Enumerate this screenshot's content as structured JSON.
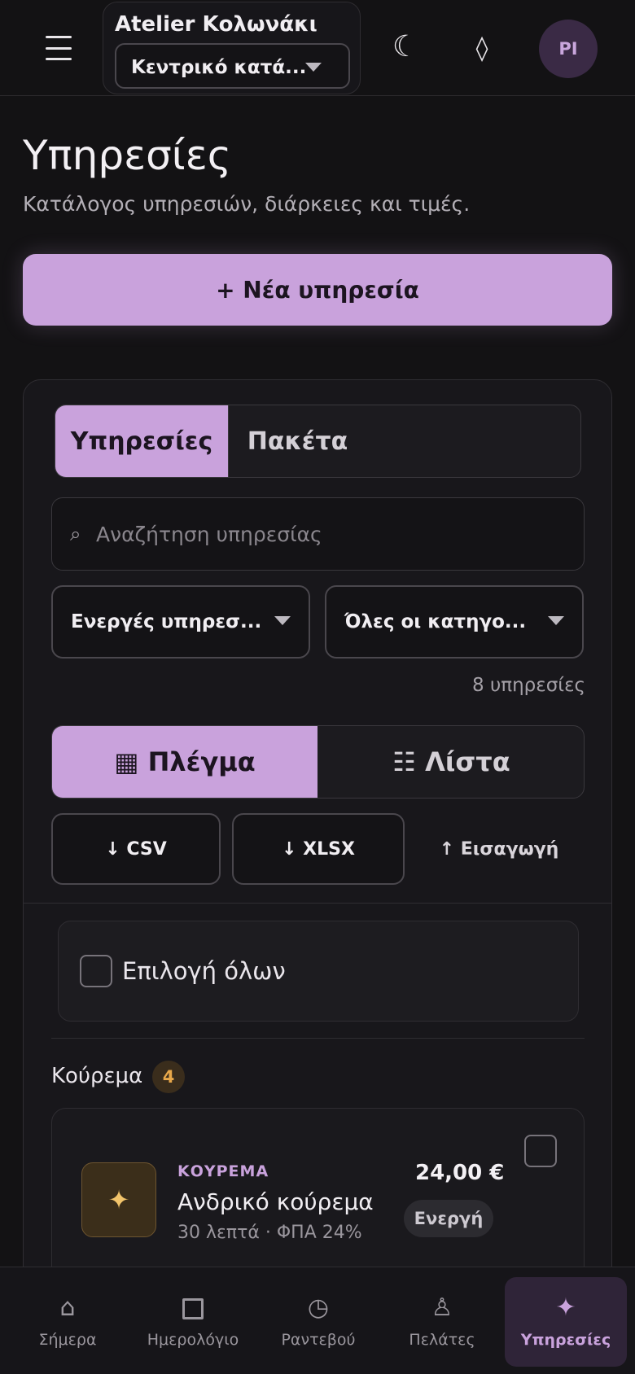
{
  "header": {
    "workspace_name": "Atelier Κολωνάκι",
    "location": "Κεντρικό κατά...",
    "theme_icon": "moon-icon",
    "extra_icon": "diamond-icon",
    "avatar_initials": "PI"
  },
  "page": {
    "title": "Υπηρεσίες",
    "subtitle": "Κατάλογος υπηρεσιών, διάρκειες και τιμές.",
    "new_button": "+ Νέα υπηρεσία"
  },
  "tabs": [
    {
      "label": "Υπηρεσίες",
      "active": true
    },
    {
      "label": "Πακέτα",
      "active": false
    }
  ],
  "search": {
    "placeholder": "Αναζήτηση υπηρεσίας",
    "icon": "⌕"
  },
  "filters": {
    "status": "Ενεργές υπηρεσ...",
    "category": "Όλες οι κατηγο..."
  },
  "result_count": "8 υπηρεσίες",
  "views": [
    {
      "label": "▦ Πλέγμα",
      "active": true
    },
    {
      "label": "☷ Λίστα",
      "active": false
    }
  ],
  "actions": {
    "csv": "↓ CSV",
    "xlsx": "↓ XLSX",
    "import": "↑ Εισαγωγή"
  },
  "select_all_label": "Επιλογή όλων",
  "category_group": {
    "name": "Κούρεμα",
    "count": "4"
  },
  "services": [
    {
      "category": "ΚΟΥΡΕΜΑ",
      "name": "Ανδρικό κούρεμα",
      "meta": "30 λεπτά · ΦΠΑ 24%",
      "price": "24,00 €",
      "status": "Ενεργή",
      "icon": "✦"
    }
  ],
  "bottom_nav": [
    {
      "label": "Σήμερα",
      "icon": "⌂",
      "active": false
    },
    {
      "label": "Ημερολόγιο",
      "icon": "square",
      "active": false
    },
    {
      "label": "Ραντεβού",
      "icon": "◷",
      "active": false
    },
    {
      "label": "Πελάτες",
      "icon": "♙",
      "active": false
    },
    {
      "label": "Υπηρεσίες",
      "icon": "✦",
      "active": true
    }
  ],
  "colors": {
    "accent": "#c9a2dc",
    "background": "#131214",
    "category_badge": "#e8a84a"
  }
}
